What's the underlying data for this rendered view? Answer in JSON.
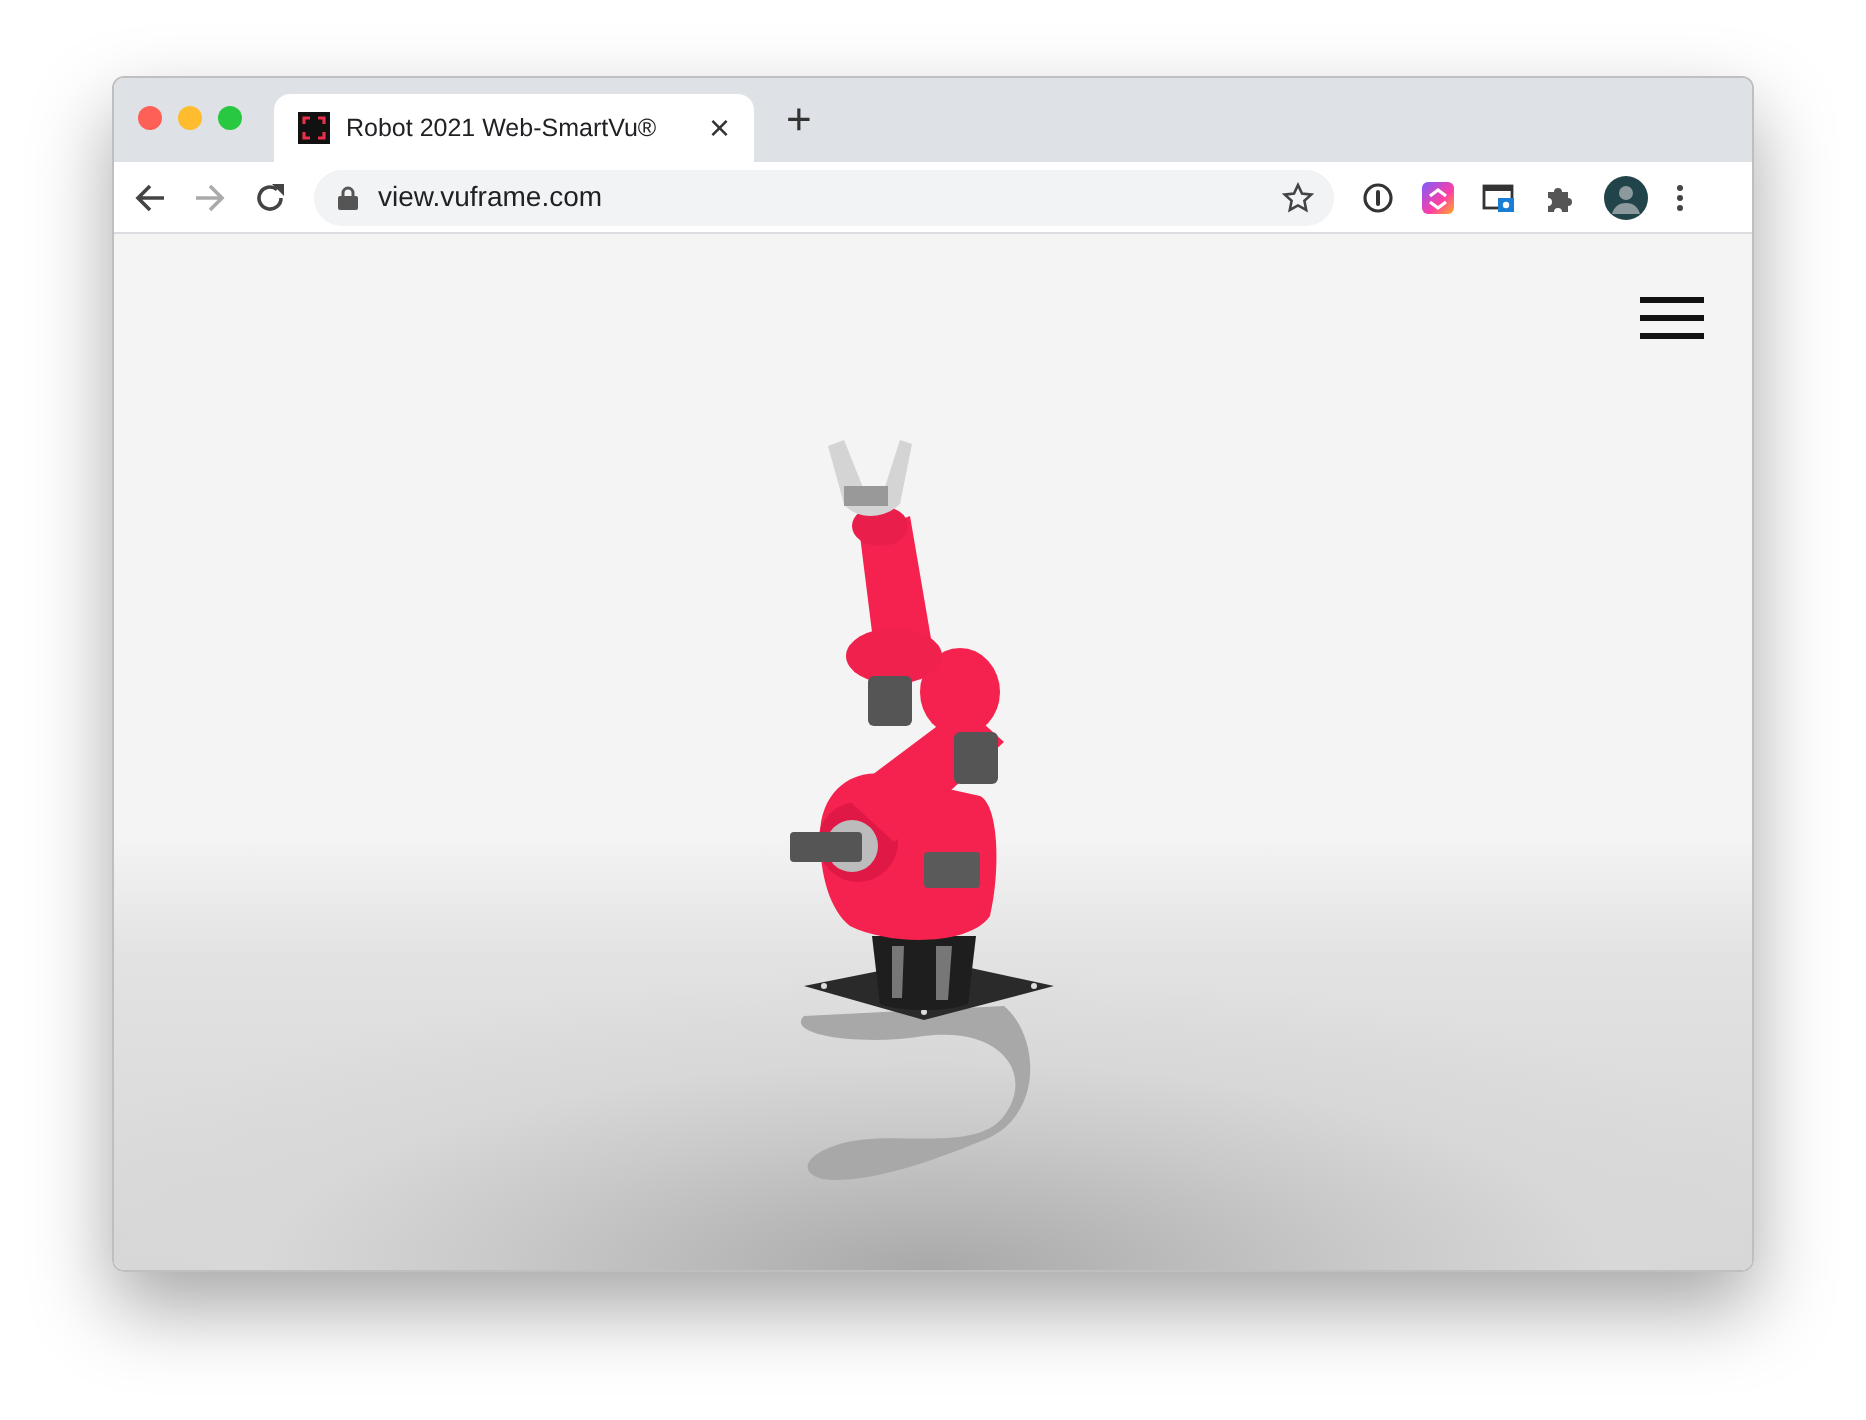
{
  "tab": {
    "title": "Robot 2021 Web-SmartVu®",
    "selected": true,
    "close": "×"
  },
  "new_tab": "+",
  "address_bar": {
    "url": "view.vuframe.com"
  }
}
